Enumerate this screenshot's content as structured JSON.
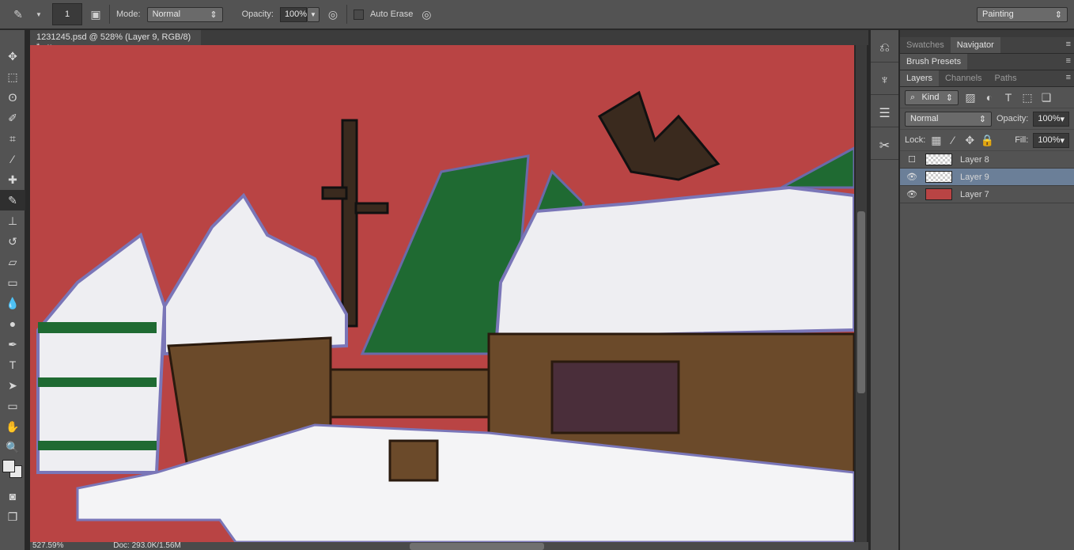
{
  "options_bar": {
    "brush_size": "1",
    "mode_label": "Mode:",
    "mode_value": "Normal",
    "opacity_label": "Opacity:",
    "opacity_value": "100%",
    "auto_erase_label": "Auto Erase",
    "workspace": "Painting"
  },
  "document": {
    "tab_title": "1231245.psd @ 528% (Layer 9, RGB/8) *",
    "close": "×",
    "canvas_color": "#b94444"
  },
  "status": {
    "zoom": "527.59%",
    "doc": "Doc: 293.0K/1.56M"
  },
  "panels": {
    "top_tabs": [
      "Swatches",
      "Navigator"
    ],
    "brush_tab": "Brush Presets",
    "layer_tabs": [
      "Layers",
      "Channels",
      "Paths"
    ],
    "filter_kind": "Kind",
    "blend_mode": "Normal",
    "opacity_label": "Opacity:",
    "opacity_value": "100%",
    "lock_label": "Lock:",
    "fill_label": "Fill:",
    "fill_value": "100%",
    "layers": [
      {
        "name": "Layer 8",
        "visible": false
      },
      {
        "name": "Layer 9",
        "visible": true,
        "selected": true
      },
      {
        "name": "Layer 7",
        "visible": true
      }
    ]
  }
}
